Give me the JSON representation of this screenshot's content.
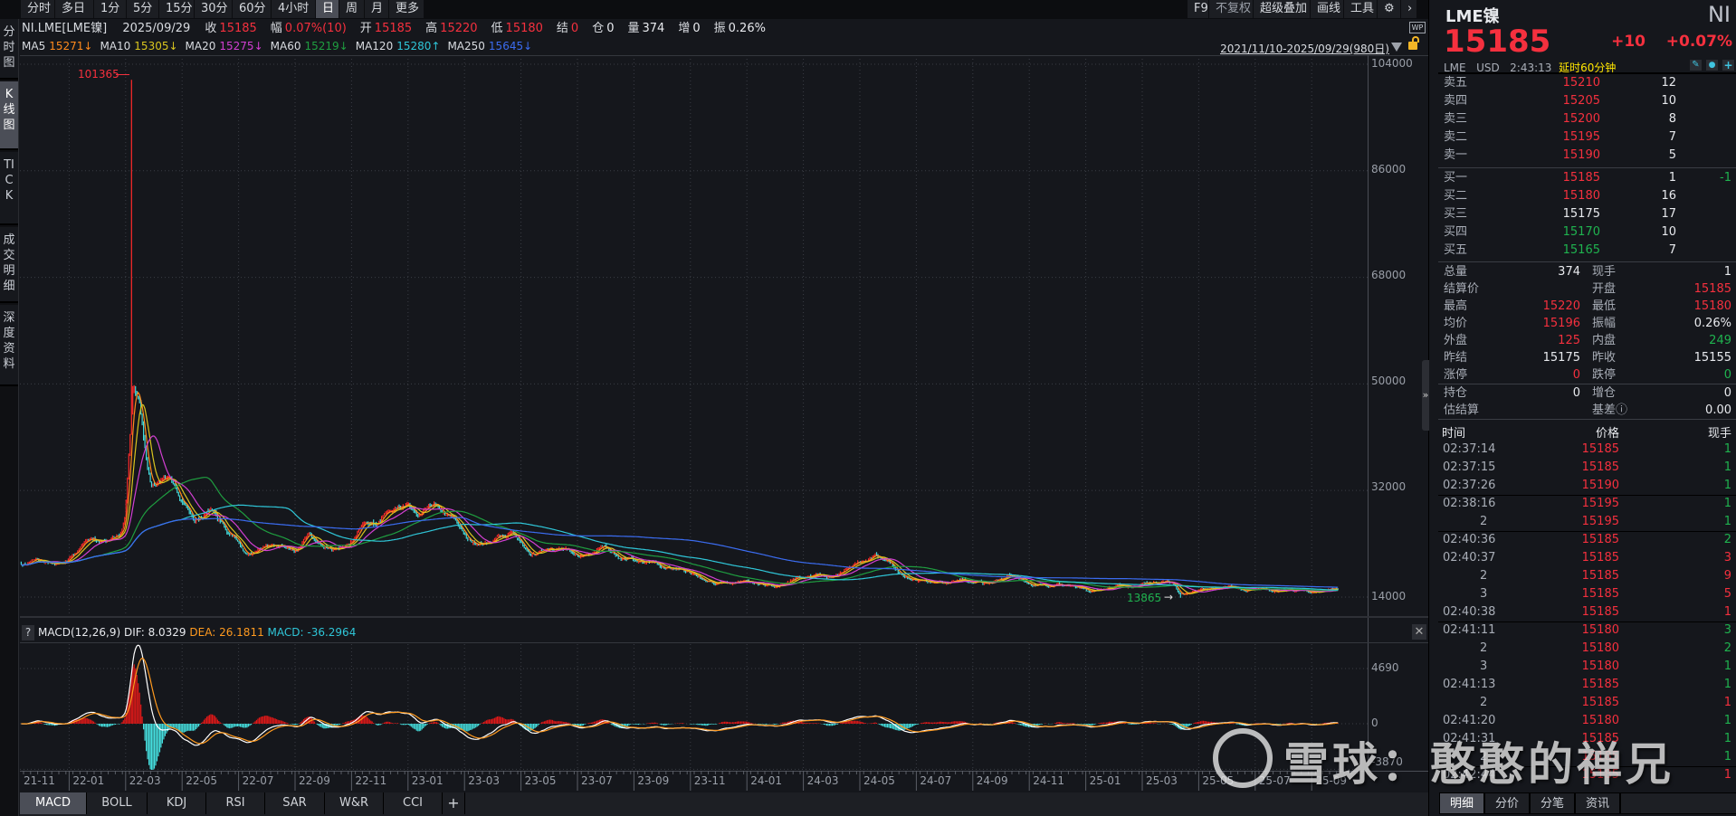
{
  "toolbar": {
    "periods": [
      "分时",
      "多日",
      "1分",
      "5分",
      "15分",
      "30分",
      "60分",
      "4小时",
      "日",
      "周",
      "月",
      "更多"
    ],
    "active_index": 8,
    "right_buttons": [
      "F9",
      "不复权",
      "超级叠加",
      "画线",
      "工具"
    ],
    "settings_icon": "gear-icon",
    "next_icon": "chevron-right-icon"
  },
  "sidebar": [
    "分时图",
    "K线图",
    "TICK",
    "成交明细",
    "深度资料"
  ],
  "sidebar_active_index": 1,
  "info": {
    "symbol": "NI.LME[LME镍]",
    "date": "2025/09/29",
    "fields": [
      {
        "k": "收",
        "v": "15185",
        "c": "red"
      },
      {
        "k": "幅",
        "v": "0.07%(10)",
        "c": "red"
      },
      {
        "k": "开",
        "v": "15185",
        "c": "red"
      },
      {
        "k": "高",
        "v": "15220",
        "c": "red"
      },
      {
        "k": "低",
        "v": "15180",
        "c": "red"
      },
      {
        "k": "结",
        "v": "0",
        "c": "red"
      },
      {
        "k": "仓",
        "v": "0",
        "c": "white"
      },
      {
        "k": "量",
        "v": "374",
        "c": "white"
      },
      {
        "k": "增",
        "v": "0",
        "c": "white"
      },
      {
        "k": "振",
        "v": "0.26%",
        "c": "white"
      }
    ]
  },
  "ma": [
    {
      "label": "MA5",
      "value": "15271",
      "arrow": "↓",
      "color": "#ff8a1c",
      "period": 5
    },
    {
      "label": "MA10",
      "value": "15305",
      "arrow": "↓",
      "color": "#d9c51f",
      "period": 10
    },
    {
      "label": "MA20",
      "value": "15275",
      "arrow": "↓",
      "color": "#d23fd2",
      "period": 20
    },
    {
      "label": "MA60",
      "value": "15219",
      "arrow": "↓",
      "color": "#1f9e40",
      "period": 60
    },
    {
      "label": "MA120",
      "value": "15280",
      "arrow": "↑",
      "color": "#2fc6d8",
      "period": 120
    },
    {
      "label": "MA250",
      "value": "15645",
      "arrow": "↓",
      "color": "#3b6cf0",
      "period": 250
    }
  ],
  "range_label": "2021/11/10-2025/09/29(980日)",
  "price_axis": [
    "104000",
    "86000",
    "68000",
    "50000",
    "32000",
    "14000"
  ],
  "annotations": {
    "high": "101365",
    "low": "13865"
  },
  "colors": {
    "up": "#ff2a2a",
    "down": "#45dede",
    "red": "#f5303e",
    "green": "#1fb34f",
    "dif": "#ffffff",
    "dea": "#ff9a1f"
  },
  "chart_data": {
    "type": "candlestick",
    "title": "NI.LME[LME镍]",
    "bars": 980,
    "ylim": [
      14000,
      104000
    ],
    "high_extreme": 101365,
    "low_extreme": 13865,
    "keypoints_month_price": [
      [
        0.26,
        19650
      ],
      [
        1.92,
        20100
      ],
      [
        2.63,
        22860
      ],
      [
        3.78,
        24240
      ],
      [
        3.97,
        27300
      ],
      [
        4.26,
        48700
      ],
      [
        4.49,
        46100
      ],
      [
        4.71,
        37400
      ],
      [
        4.9,
        33400
      ],
      [
        5.77,
        33400
      ],
      [
        6.19,
        29300
      ],
      [
        6.47,
        27400
      ],
      [
        6.99,
        28800
      ],
      [
        7.63,
        24700
      ],
      [
        8.33,
        21200
      ],
      [
        8.78,
        22100
      ],
      [
        9.36,
        22400
      ],
      [
        10.06,
        21600
      ],
      [
        10.48,
        24400
      ],
      [
        11.06,
        22400
      ],
      [
        11.92,
        22700
      ],
      [
        12.44,
        26200
      ],
      [
        12.85,
        26200
      ],
      [
        13.49,
        29000
      ],
      [
        14.01,
        29700
      ],
      [
        14.36,
        27400
      ],
      [
        14.94,
        29600
      ],
      [
        15.64,
        26700
      ],
      [
        16.35,
        23500
      ],
      [
        17.08,
        23500
      ],
      [
        17.66,
        25000
      ],
      [
        18.37,
        21300
      ],
      [
        19.23,
        21900
      ],
      [
        20.22,
        21300
      ],
      [
        20.93,
        22100
      ],
      [
        21.51,
        20400
      ],
      [
        22.5,
        20100
      ],
      [
        23.65,
        18600
      ],
      [
        24.84,
        16750
      ],
      [
        26.19,
        16450
      ],
      [
        27.34,
        16100
      ],
      [
        28.37,
        18100
      ],
      [
        28.85,
        17400
      ],
      [
        29.71,
        19000
      ],
      [
        30.54,
        21200
      ],
      [
        31.03,
        19650
      ],
      [
        31.54,
        17500
      ],
      [
        32.72,
        16100
      ],
      [
        33.72,
        16750
      ],
      [
        34.39,
        16100
      ],
      [
        35.22,
        18000
      ],
      [
        36.06,
        16300
      ],
      [
        37.08,
        15950
      ],
      [
        38.08,
        15400
      ],
      [
        39.26,
        15700
      ],
      [
        40.42,
        16450
      ],
      [
        41.09,
        16100
      ],
      [
        41.35,
        14450
      ],
      [
        41.7,
        15200
      ],
      [
        42.95,
        15700
      ],
      [
        43.78,
        15100
      ],
      [
        45.45,
        15200
      ],
      [
        46.96,
        15185
      ]
    ]
  },
  "macd": {
    "help": "?",
    "title": "MACD(12,26,9)",
    "dif": "DIF: 8.0329",
    "dea": "DEA: 26.1811",
    "macd": "MACD: -36.2964",
    "axis": [
      "4690",
      "0",
      "-3870"
    ],
    "axis_values": [
      4690,
      0,
      -3870
    ]
  },
  "x_axis": [
    "21-11",
    "22-01",
    "22-03",
    "22-05",
    "22-07",
    "22-09",
    "22-11",
    "23-01",
    "23-03",
    "23-05",
    "23-07",
    "23-09",
    "23-11",
    "24-01",
    "24-03",
    "24-05",
    "24-07",
    "24-09",
    "24-11",
    "25-01",
    "25-03",
    "25-05",
    "25-07",
    "25-09"
  ],
  "indicator_tabs": [
    "MACD",
    "BOLL",
    "KDJ",
    "RSI",
    "SAR",
    "W&R",
    "CCI"
  ],
  "indicator_add": "+",
  "quote": {
    "name": "LME镍",
    "code": "NI",
    "price": "15185",
    "change": "+10",
    "pct": "+0.07%",
    "exchange": "LME",
    "currency": "USD",
    "time": "2:43:13",
    "delay": "延时60分钟",
    "asks": [
      {
        "l": "卖五",
        "p": "15210",
        "q": "12",
        "c": "red"
      },
      {
        "l": "卖四",
        "p": "15205",
        "q": "10",
        "c": "red"
      },
      {
        "l": "卖三",
        "p": "15200",
        "q": "8",
        "c": "red"
      },
      {
        "l": "卖二",
        "p": "15195",
        "q": "7",
        "c": "red"
      },
      {
        "l": "卖一",
        "p": "15190",
        "q": "5",
        "c": "red"
      }
    ],
    "bids": [
      {
        "l": "买一",
        "p": "15185",
        "q": "1",
        "d": "-1",
        "c": "red"
      },
      {
        "l": "买二",
        "p": "15180",
        "q": "16",
        "c": "red"
      },
      {
        "l": "买三",
        "p": "15175",
        "q": "17",
        "c": "white"
      },
      {
        "l": "买四",
        "p": "15170",
        "q": "10",
        "c": "green"
      },
      {
        "l": "买五",
        "p": "15165",
        "q": "7",
        "c": "green"
      }
    ],
    "stats": [
      {
        "l1": "总量",
        "v1": "374",
        "c1": "white",
        "l2": "现手",
        "v2": "1",
        "c2": "white"
      },
      {
        "l1": "结算价",
        "v1": "",
        "c1": "white",
        "l2": "开盘",
        "v2": "15185",
        "c2": "red"
      },
      {
        "l1": "最高",
        "v1": "15220",
        "c1": "red",
        "l2": "最低",
        "v2": "15180",
        "c2": "red"
      },
      {
        "l1": "均价",
        "v1": "15196",
        "c1": "red",
        "l2": "振幅",
        "v2": "0.26%",
        "c2": "white"
      },
      {
        "l1": "外盘",
        "v1": "125",
        "c1": "red",
        "l2": "内盘",
        "v2": "249",
        "c2": "green"
      },
      {
        "l1": "昨结",
        "v1": "15175",
        "c1": "white",
        "l2": "昨收",
        "v2": "15155",
        "c2": "white"
      },
      {
        "l1": "涨停",
        "v1": "0",
        "c1": "red",
        "l2": "跌停",
        "v2": "0",
        "c2": "green"
      }
    ],
    "stats2": [
      {
        "l1": "持仓",
        "v1": "0",
        "c1": "white",
        "l2": "增仓",
        "v2": "0",
        "c2": "white"
      },
      {
        "l1": "估结算",
        "v1": "",
        "c1": "white",
        "l2": "基差ⓘ",
        "v2": "0.00",
        "c2": "white"
      }
    ],
    "trade_header": [
      "时间",
      "价格",
      "现手"
    ],
    "trades": [
      {
        "t": "02:37:14",
        "p": "15185",
        "q": "1",
        "c": "green"
      },
      {
        "t": "02:37:15",
        "p": "15185",
        "q": "1",
        "c": "green"
      },
      {
        "t": "02:37:26",
        "p": "15190",
        "q": "1",
        "c": "green",
        "sep": true
      },
      {
        "t": "02:38:16",
        "p": "15195",
        "q": "1",
        "c": "green"
      },
      {
        "t": "2",
        "p": "15195",
        "q": "1",
        "c": "green",
        "sep": true
      },
      {
        "t": "02:40:36",
        "p": "15185",
        "q": "2",
        "c": "green"
      },
      {
        "t": "02:40:37",
        "p": "15185",
        "q": "3",
        "c": "red"
      },
      {
        "t": "2",
        "p": "15185",
        "q": "9",
        "c": "red"
      },
      {
        "t": "3",
        "p": "15185",
        "q": "5",
        "c": "red"
      },
      {
        "t": "02:40:38",
        "p": "15185",
        "q": "1",
        "c": "red",
        "sep": true
      },
      {
        "t": "02:41:11",
        "p": "15180",
        "q": "3",
        "c": "green"
      },
      {
        "t": "2",
        "p": "15180",
        "q": "2",
        "c": "green"
      },
      {
        "t": "3",
        "p": "15180",
        "q": "1",
        "c": "green"
      },
      {
        "t": "02:41:13",
        "p": "15185",
        "q": "1",
        "c": "green"
      },
      {
        "t": "2",
        "p": "15185",
        "q": "1",
        "c": "red"
      },
      {
        "t": "02:41:20",
        "p": "15180",
        "q": "1",
        "c": "green"
      },
      {
        "t": "02:41:31",
        "p": "15185",
        "q": "1",
        "c": "green"
      },
      {
        "t": "2",
        "p": "15185",
        "q": "1",
        "c": "green",
        "sep": true
      },
      {
        "t": "02:42:44",
        "p": "15185",
        "q": "1",
        "c": "red"
      }
    ],
    "tabs": [
      "明细",
      "分价",
      "分笔",
      "资讯"
    ],
    "active_tab": 0
  },
  "watermark": "雪球：憨憨的禅兄"
}
